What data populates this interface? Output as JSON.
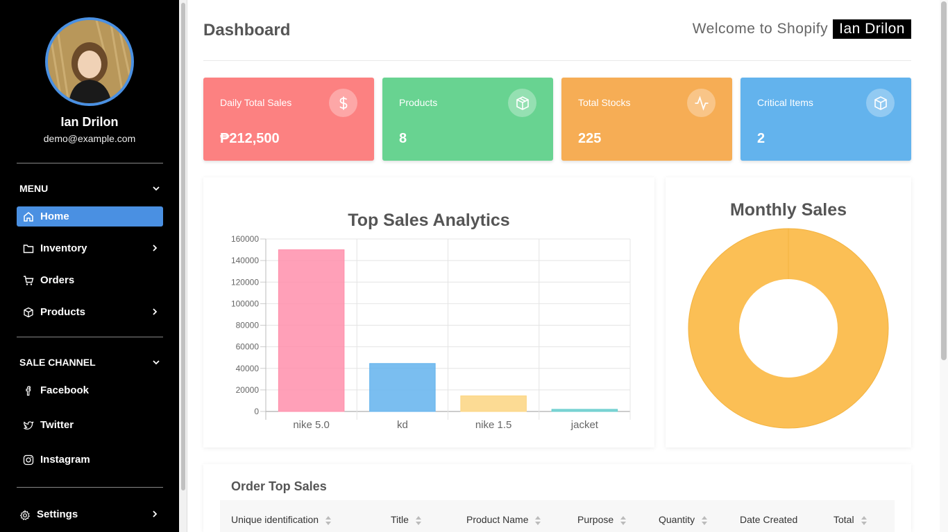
{
  "user": {
    "name": "Ian Drilon",
    "email": "demo@example.com"
  },
  "menu": {
    "title": "MENU",
    "items": [
      {
        "label": "Home",
        "icon": "home-icon",
        "active": true
      },
      {
        "label": "Inventory",
        "icon": "folder-icon"
      },
      {
        "label": "Orders",
        "icon": "cart-icon"
      },
      {
        "label": "Products",
        "icon": "box-icon"
      }
    ]
  },
  "sale_channel": {
    "title": "SALE CHANNEL",
    "items": [
      {
        "label": "Facebook",
        "icon": "facebook-icon"
      },
      {
        "label": "Twitter",
        "icon": "twitter-icon"
      },
      {
        "label": "Instagram",
        "icon": "instagram-icon"
      }
    ]
  },
  "settings": {
    "label": "Settings",
    "icon": "gear-icon"
  },
  "header": {
    "title": "Dashboard",
    "welcome": "Welcome to Shopify",
    "user_tag": "Ian Drilon"
  },
  "cards": [
    {
      "label": "Daily Total Sales",
      "value": "₱212,500",
      "icon": "dollar-icon",
      "color": "#fc8181"
    },
    {
      "label": "Products",
      "value": "8",
      "icon": "box-icon",
      "color": "#68d391"
    },
    {
      "label": "Total Stocks",
      "value": "225",
      "icon": "activity-icon",
      "color": "#f6ad55"
    },
    {
      "label": "Critical Items",
      "value": "2",
      "icon": "box-icon",
      "color": "#63b3ed"
    }
  ],
  "top_sales": {
    "title": "Top Sales Analytics"
  },
  "monthly": {
    "title": "Monthly Sales"
  },
  "orders": {
    "title": "Order Top Sales",
    "columns": [
      "Unique identification",
      "Title",
      "Product Name",
      "Purpose",
      "Quantity",
      "Date Created",
      "Total"
    ]
  },
  "chart_data": [
    {
      "type": "bar",
      "title": "Top Sales Analytics",
      "categories": [
        "nike 5.0",
        "kd",
        "nike 1.5",
        "jacket"
      ],
      "values": [
        150000,
        44500,
        14500,
        2000
      ],
      "colors": [
        "#ff8fab",
        "#63b3ed",
        "#fcd581",
        "#66cccc"
      ],
      "ylim": [
        0,
        160000
      ],
      "yticks": [
        "0",
        "20000",
        "40000",
        "60000",
        "80000",
        "100000",
        "120000",
        "140000",
        "160000"
      ],
      "grid": true
    },
    {
      "type": "pie",
      "title": "Monthly Sales",
      "values": [
        100
      ],
      "colors": [
        "#fbbf55"
      ]
    }
  ]
}
